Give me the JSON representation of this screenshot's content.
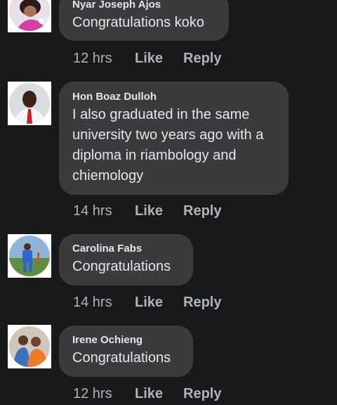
{
  "comments": [
    {
      "author": "Nyar Joseph Ajos",
      "text": "Congratulations koko",
      "time": "12 hrs",
      "like": "Like",
      "reply": "Reply"
    },
    {
      "author": "Hon Boaz Dulloh",
      "text": "I also graduated in the same university two years ago with a diploma in riambology and chiemology",
      "time": "14 hrs",
      "like": "Like",
      "reply": "Reply"
    },
    {
      "author": "Carolina Fabs",
      "text": "Congratulations",
      "time": "14 hrs",
      "like": "Like",
      "reply": "Reply"
    },
    {
      "author": "Irene Ochieng",
      "text": "Congratulations",
      "time": "12 hrs",
      "like": "Like",
      "reply": "Reply"
    }
  ],
  "colors": {
    "background": "#18191a",
    "bubble": "#3a3b3c",
    "text": "#e4e6eb",
    "muted": "#b0b3b8"
  }
}
